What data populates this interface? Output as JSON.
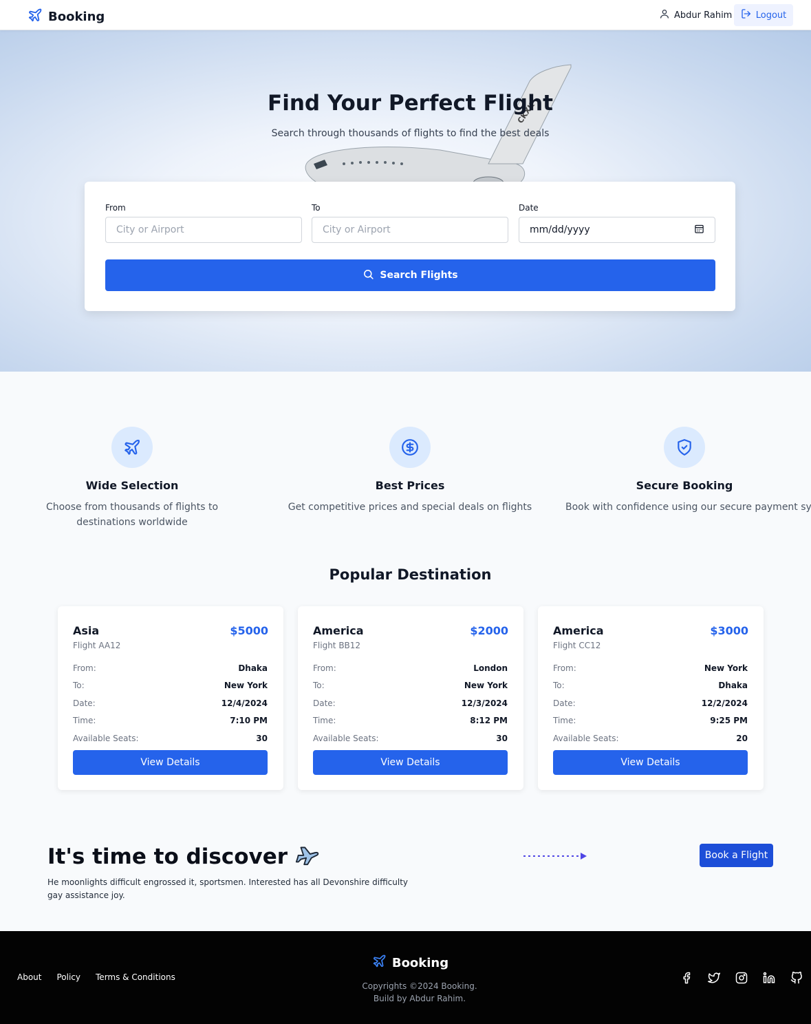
{
  "header": {
    "brand": "Booking",
    "user_name": "Abdur Rahim",
    "logout_label": "Logout"
  },
  "hero": {
    "title": "Find Your Perfect Flight",
    "subtitle": "Search through thousands of flights to find the best deals",
    "plane_tail_text": "CKXK"
  },
  "search": {
    "from_label": "From",
    "from_placeholder": "City or Airport",
    "to_label": "To",
    "to_placeholder": "City or Airport",
    "date_label": "Date",
    "date_value": "mm/dd/yyyy",
    "button_label": "Search Flights"
  },
  "features": [
    {
      "icon": "plane-icon",
      "title": "Wide Selection",
      "desc": "Choose from thousands of flights to destinations worldwide"
    },
    {
      "icon": "dollar-icon",
      "title": "Best Prices",
      "desc": "Get competitive prices and special deals on flights"
    },
    {
      "icon": "shield-check-icon",
      "title": "Secure Booking",
      "desc": "Book with confidence using our secure payment system"
    }
  ],
  "popular": {
    "title": "Popular Destination",
    "labels": {
      "from": "From:",
      "to": "To:",
      "date": "Date:",
      "time": "Time:",
      "seats": "Available Seats:"
    },
    "button_label": "View Details",
    "cards": [
      {
        "region": "Asia",
        "price": "$5000",
        "flight": "Flight AA12",
        "from": "Dhaka",
        "to": "New York",
        "date": "12/4/2024",
        "time": "7:10 PM",
        "seats": "30"
      },
      {
        "region": "America",
        "price": "$2000",
        "flight": "Flight BB12",
        "from": "London",
        "to": "New York",
        "date": "12/3/2024",
        "time": "8:12 PM",
        "seats": "30"
      },
      {
        "region": "America",
        "price": "$3000",
        "flight": "Flight CC12",
        "from": "New York",
        "to": "Dhaka",
        "date": "12/2/2024",
        "time": "9:25 PM",
        "seats": "20"
      }
    ]
  },
  "discover": {
    "title": "It's time to discover",
    "text": "He moonlights difficult engrossed it, sportsmen. Interested has all Devonshire difficulty gay assistance joy.",
    "button_label": "Book a Flight"
  },
  "footer": {
    "links": [
      "About",
      "Policy",
      "Terms & Conditions"
    ],
    "brand": "Booking",
    "copyright": "Copyrights ©2024 Booking.",
    "credit": "Build by Abdur Rahim.",
    "socials": [
      "facebook-icon",
      "twitter-icon",
      "instagram-icon",
      "linkedin-icon",
      "github-icon"
    ]
  },
  "colors": {
    "primary": "#2563eb",
    "footer_bg": "#030303",
    "page_bg": "#f8fafc",
    "icon_circle": "#dbeafe"
  }
}
